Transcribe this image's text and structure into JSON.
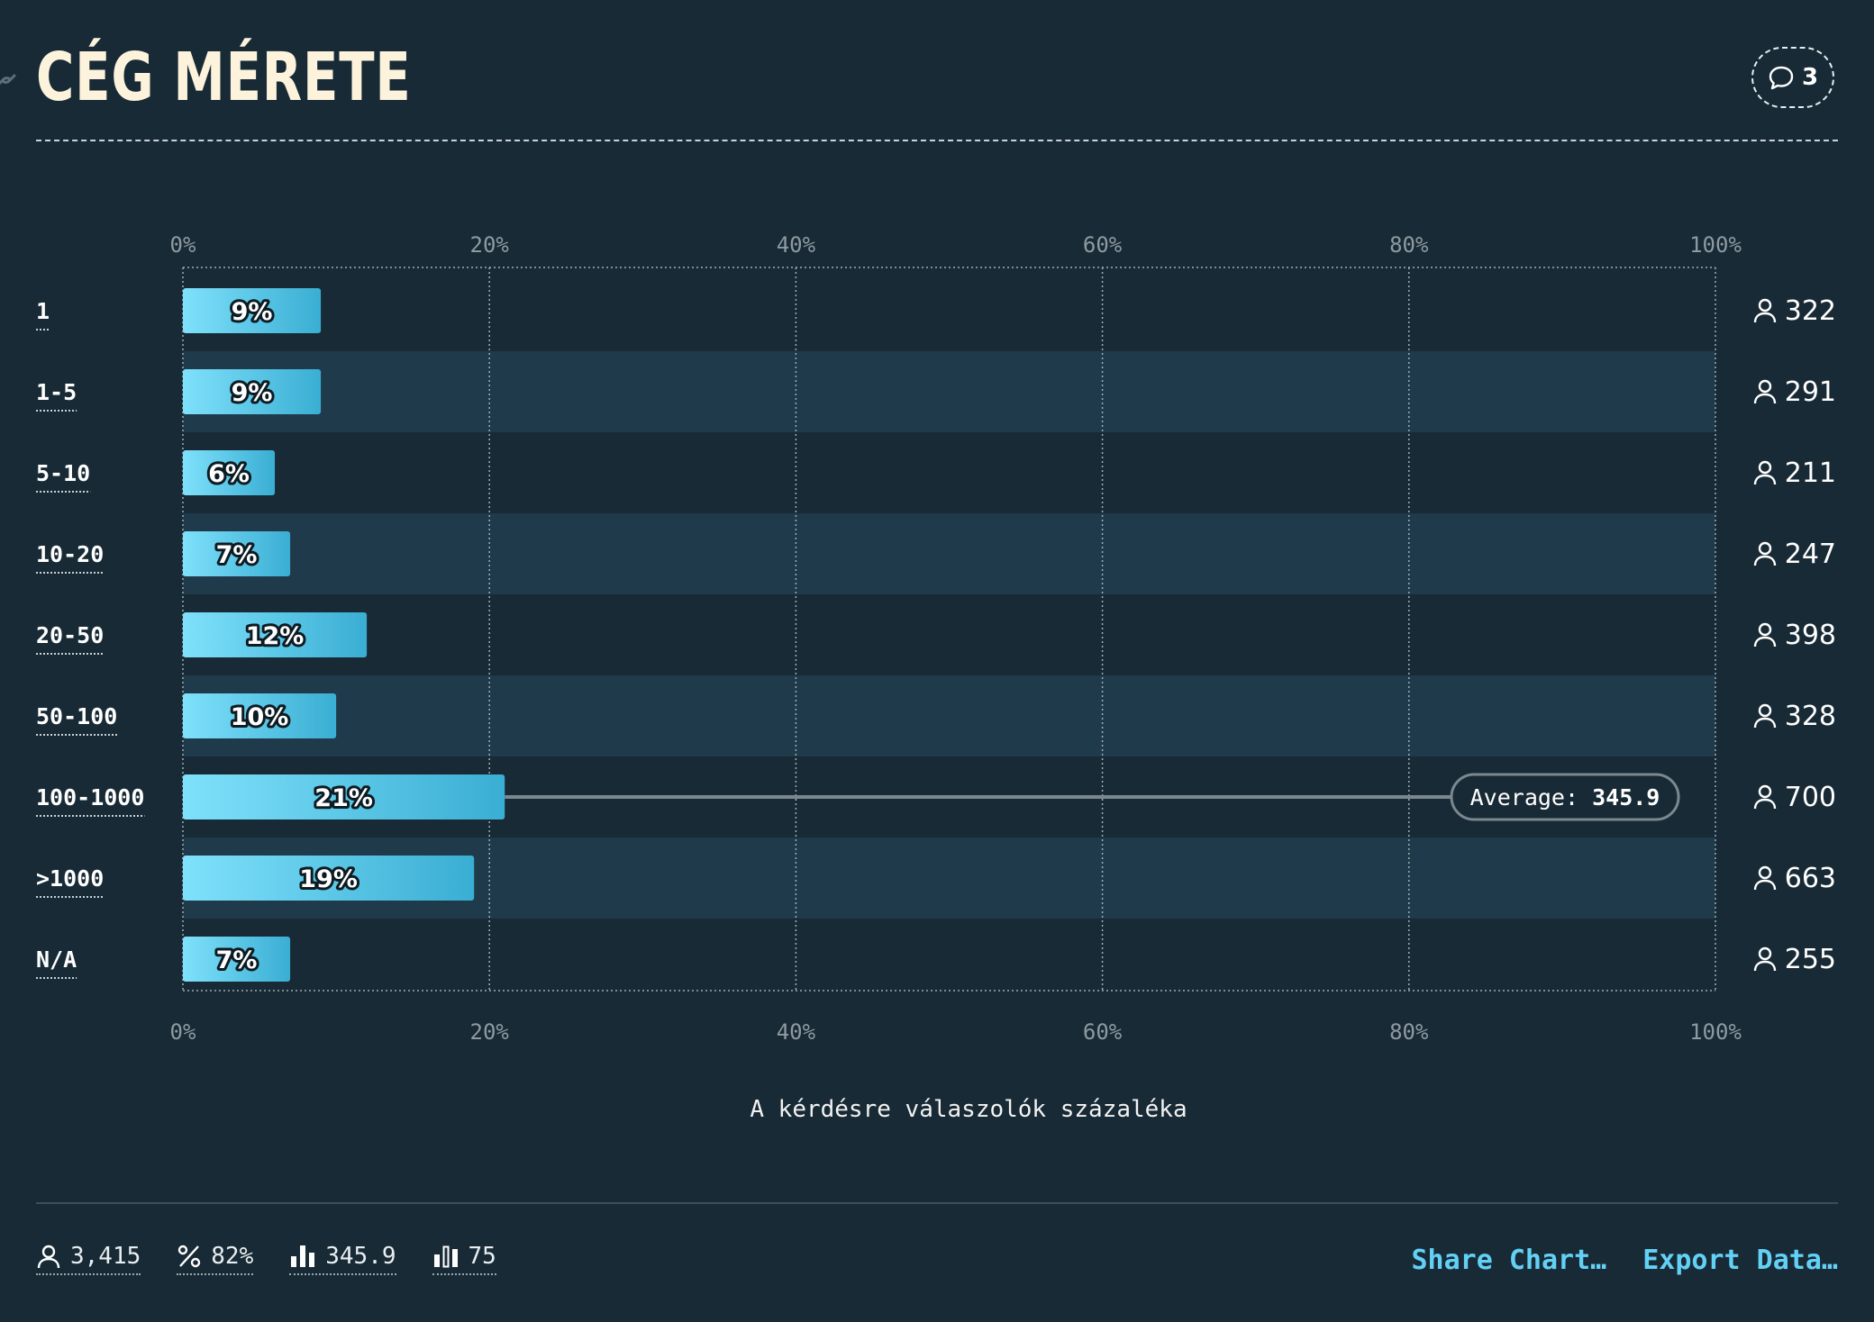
{
  "header": {
    "title": "CÉG MÉRETE",
    "comment_count": "3"
  },
  "chart_data": {
    "type": "bar",
    "orientation": "horizontal",
    "title": "A kérdésre válaszolók százaléka",
    "categories": [
      "1",
      "1-5",
      "5-10",
      "10-20",
      "20-50",
      "50-100",
      "100-1000",
      ">1000",
      "N/A"
    ],
    "values": [
      9,
      9,
      6,
      7,
      12,
      10,
      21,
      19,
      7
    ],
    "value_labels": [
      "9%",
      "9%",
      "6%",
      "7%",
      "12%",
      "10%",
      "21%",
      "19%",
      "7%"
    ],
    "counts": [
      "322",
      "291",
      "211",
      "247",
      "398",
      "328",
      "700",
      "663",
      "255"
    ],
    "xlim": [
      0,
      100
    ],
    "x_ticks": [
      "0%",
      "20%",
      "40%",
      "60%",
      "80%",
      "100%"
    ],
    "grid": true,
    "average": {
      "label": "Average:",
      "value": "345.9",
      "category": "100-1000"
    },
    "colors": {
      "bar_start": "#7fe1fb",
      "bar_end": "#3aaed3",
      "band": "#1f3a4a",
      "grid": "#9eadb5",
      "avg_line": "#7b8890"
    }
  },
  "footer": {
    "stats": [
      {
        "icon": "person-icon",
        "value": "3,415"
      },
      {
        "icon": "percent-icon",
        "value": "82%"
      },
      {
        "icon": "bar-chart-icon",
        "value": "345.9"
      },
      {
        "icon": "bar-chart-outline-icon",
        "value": "75"
      }
    ],
    "share_label": "Share Chart…",
    "export_label": "Export Data…"
  }
}
